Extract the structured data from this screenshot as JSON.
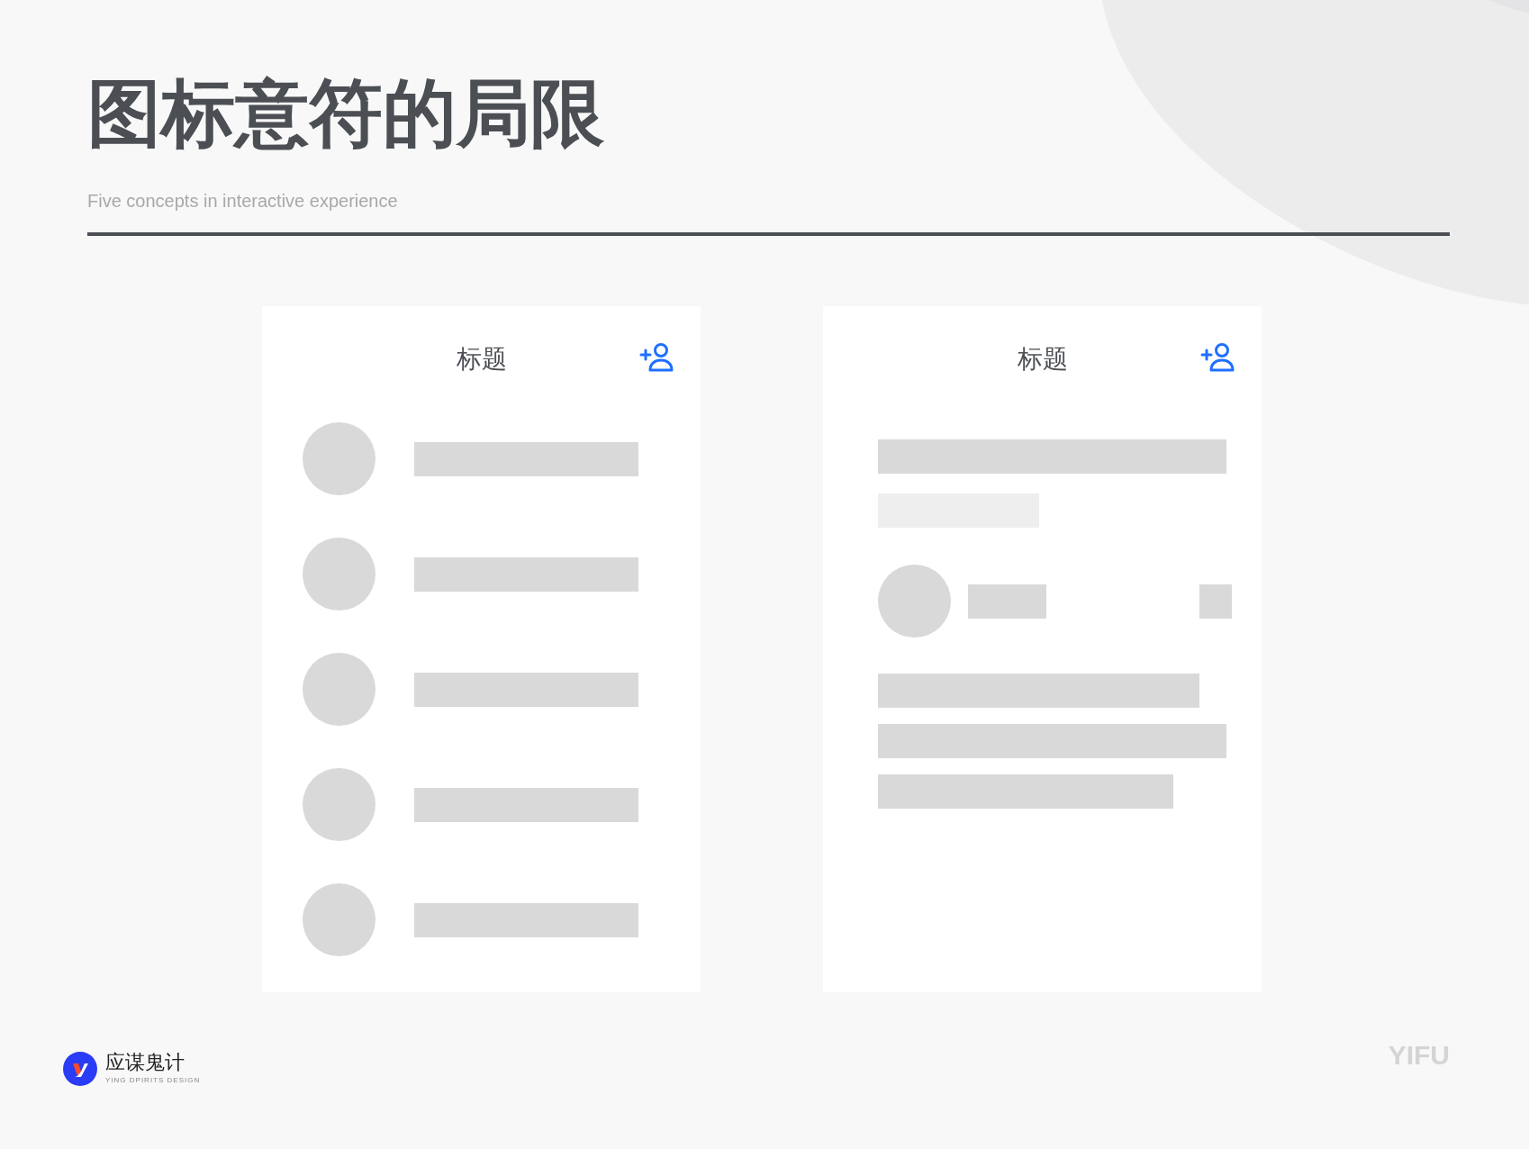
{
  "title": "图标意符的局限",
  "subtitle": "Five concepts in interactive experience",
  "cards": [
    {
      "kind": "list",
      "heading": "标题"
    },
    {
      "kind": "article",
      "heading": "标题"
    }
  ],
  "footer": {
    "brand_name": "应谋鬼计",
    "brand_tagline": "YING DPIRITS DESIGN",
    "mark": "YIFU"
  }
}
